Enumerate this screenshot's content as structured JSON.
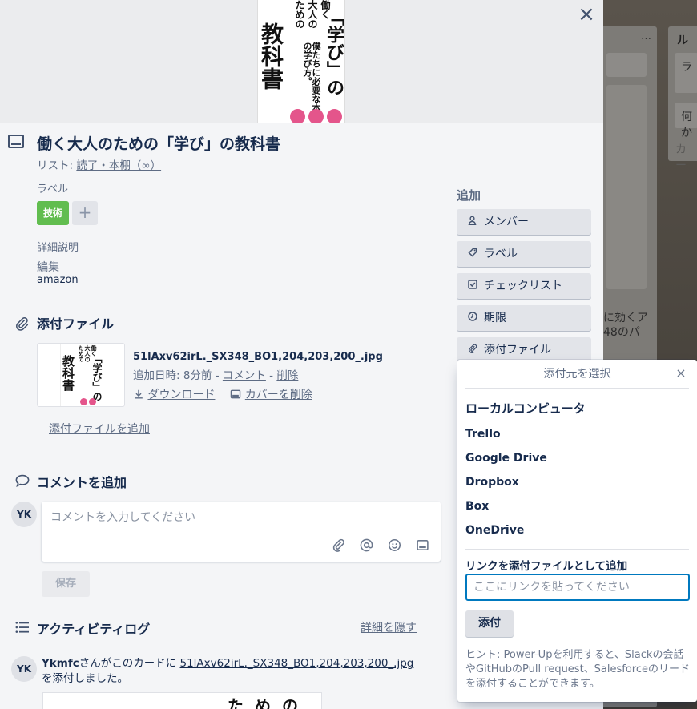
{
  "modal": {
    "close_icon": "×",
    "cover": {
      "book_top_lines": [
        "働く",
        "大人の",
        "ための"
      ],
      "book_main": "「学び」の",
      "book_main2": "教科書",
      "book_sub": "僕たちに必要な本当の学び方。"
    },
    "card_title": "働く大人のための「学び」の教科書",
    "list_prefix": "リスト: ",
    "list_name": "読了・本棚（∞）",
    "labels_heading": "ラベル",
    "label_chip": "技術",
    "label_add": "+",
    "description_heading": "詳細説明",
    "description_edit": "編集",
    "description_link": "amazon",
    "attachments_heading": "添付ファイル",
    "attachment": {
      "filename": "51lAxv62irL._SX348_BO1,204,203,200_.jpg",
      "meta_prefix": "追加日時: 8分前 - ",
      "comment_link": "コメント",
      "meta_sep": " - ",
      "delete_link": "削除",
      "download_label": "ダウンロード",
      "remove_cover_label": "カバーを削除"
    },
    "add_attachment": "添付ファイルを追加",
    "comment_heading": "コメントを追加",
    "avatar_initials": "YK",
    "comment_placeholder": "コメントを入力してください",
    "save_label": "保存",
    "activity_heading": "アクティビティログ",
    "hide_details": "詳細を隠す",
    "activity": {
      "user": "Ykmfc",
      "text1": "さんがこのカードに ",
      "file_link": "51lAxv62irL._SX348_BO1,204,203,200_.jpg",
      "text2": " を添付しました。"
    }
  },
  "sidebar": {
    "heading": "追加",
    "buttons": [
      {
        "label": "メンバー"
      },
      {
        "label": "ラベル"
      },
      {
        "label": "チェックリスト"
      },
      {
        "label": "期限"
      },
      {
        "label": "添付ファイル"
      }
    ]
  },
  "popover": {
    "title": "添付元を選択",
    "close_icon": "×",
    "sources": [
      "ローカルコンピュータ",
      "Trello",
      "Google Drive",
      "Dropbox",
      "Box",
      "OneDrive"
    ],
    "link_label": "リンクを添付ファイルとして追加",
    "link_placeholder": "ここにリンクを貼ってください",
    "attach_button": "添付",
    "hint_prefix": "ヒント: ",
    "hint_link": "Power-Up",
    "hint_rest": "を利用すると、Slackの会話やGitHubのPull request、Salesforceのリードを添付することができます。"
  },
  "background_board": {
    "list_title": "ルー",
    "menu_icon": "…",
    "card_texts": [
      "ラ",
      "何か",
      "カー",
      "に効くア",
      "48のパ"
    ]
  },
  "colors": {
    "label_green": "#61bd4f",
    "focus_blue": "#0079bf",
    "modal_bg": "#f4f5f7"
  }
}
